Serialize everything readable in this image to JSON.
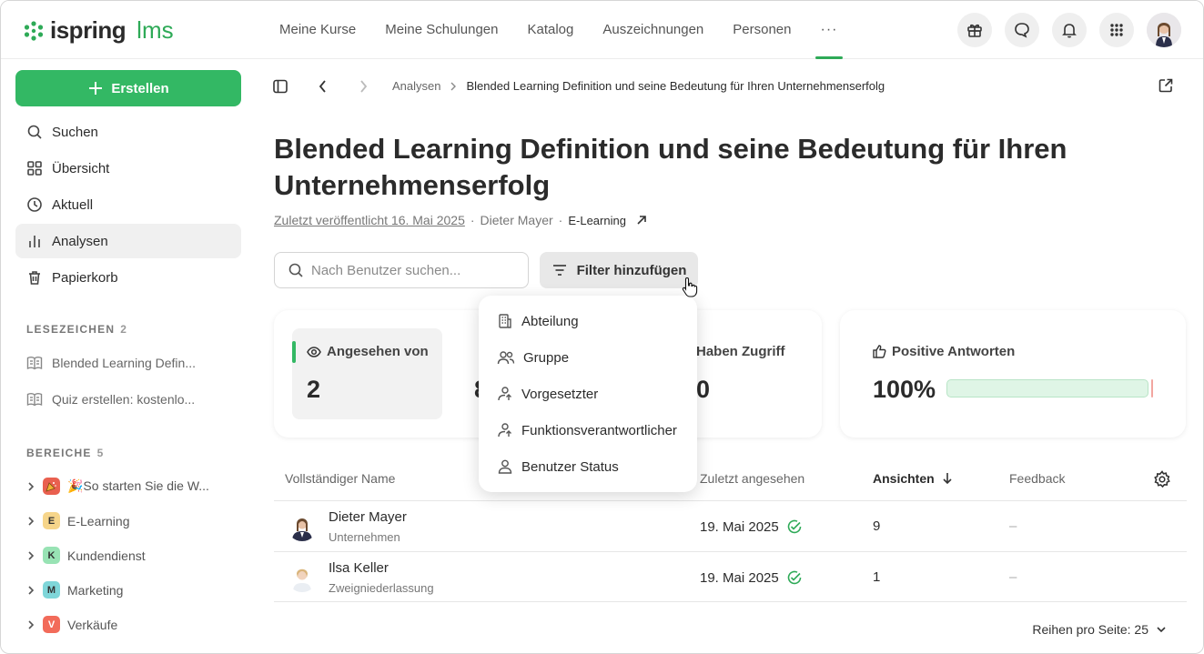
{
  "app": {
    "logo_text": "ispring",
    "logo_suffix": "lms"
  },
  "nav": {
    "items": [
      "Meine Kurse",
      "Meine Schulungen",
      "Katalog",
      "Auszeichnungen",
      "Personen"
    ],
    "more": "···"
  },
  "sidebar": {
    "create_label": "Erstellen",
    "items": [
      {
        "label": "Suchen",
        "icon": "search-icon"
      },
      {
        "label": "Übersicht",
        "icon": "grid-icon"
      },
      {
        "label": "Aktuell",
        "icon": "clock-icon"
      },
      {
        "label": "Analysen",
        "icon": "bar-chart-icon",
        "active": true
      },
      {
        "label": "Papierkorb",
        "icon": "trash-icon"
      }
    ],
    "bookmarks_header": "LESEZEICHEN",
    "bookmarks_count": "2",
    "bookmarks": [
      "Blended Learning Defin...",
      "Quiz erstellen: kostenlo..."
    ],
    "areas_header": "BEREICHE",
    "areas_count": "5",
    "areas": [
      {
        "badge": "🎉",
        "label": "🎉So starten Sie die W...",
        "color": "#e9604f"
      },
      {
        "badge": "E",
        "label": "E-Learning",
        "color": "#f6d58a"
      },
      {
        "badge": "K",
        "label": "Kundendienst",
        "color": "#98e3b4"
      },
      {
        "badge": "M",
        "label": "Marketing",
        "color": "#7fd6d9"
      },
      {
        "badge": "V",
        "label": "Verkäufe",
        "color": "#f26b5a"
      }
    ]
  },
  "breadcrumb": {
    "parent": "Analysen",
    "current": "Blended Learning Definition und seine Bedeutung für Ihren Unternehmenserfolg"
  },
  "page": {
    "title": "Blended Learning Definition und seine Bedeutung für Ihren Unternehmenserfolg",
    "published": "Zuletzt veröffentlicht 16. Mai 2025",
    "author": "Dieter Mayer",
    "area": "E-Learning"
  },
  "search": {
    "placeholder": "Nach Benutzer suchen..."
  },
  "filter": {
    "label": "Filter hinzufügen",
    "options": [
      {
        "label": "Abteilung",
        "icon": "building-icon"
      },
      {
        "label": "Gruppe",
        "icon": "group-icon"
      },
      {
        "label": "Vorgesetzter",
        "icon": "manager-icon"
      },
      {
        "label": "Funktionsverantwortlicher",
        "icon": "manager-icon"
      },
      {
        "label": "Benutzer Status",
        "icon": "user-icon"
      }
    ]
  },
  "stats": {
    "viewed_label": "Angesehen von",
    "viewed_value": "2",
    "hidden_value": "8",
    "access_label": "Haben Zugriff",
    "access_value": "0",
    "positive_label": "Positive Antworten",
    "positive_value": "100%",
    "positive_fraction": 1.0
  },
  "table": {
    "headers": {
      "name": "Vollständiger Name",
      "last_viewed": "Zuletzt angesehen",
      "views": "Ansichten",
      "feedback": "Feedback"
    },
    "rows": [
      {
        "name": "Dieter Mayer",
        "org": "Unternehmen",
        "date": "19. Mai 2025",
        "views": "9",
        "feedback": "–"
      },
      {
        "name": "Ilsa Keller",
        "org": "Zweigniederlassung",
        "date": "19. Mai 2025",
        "views": "1",
        "feedback": "–"
      }
    ]
  },
  "pager": {
    "label": "Reihen pro Seite: 25"
  },
  "colors": {
    "accent": "#33b864",
    "brand_green": "#2eaa57"
  }
}
